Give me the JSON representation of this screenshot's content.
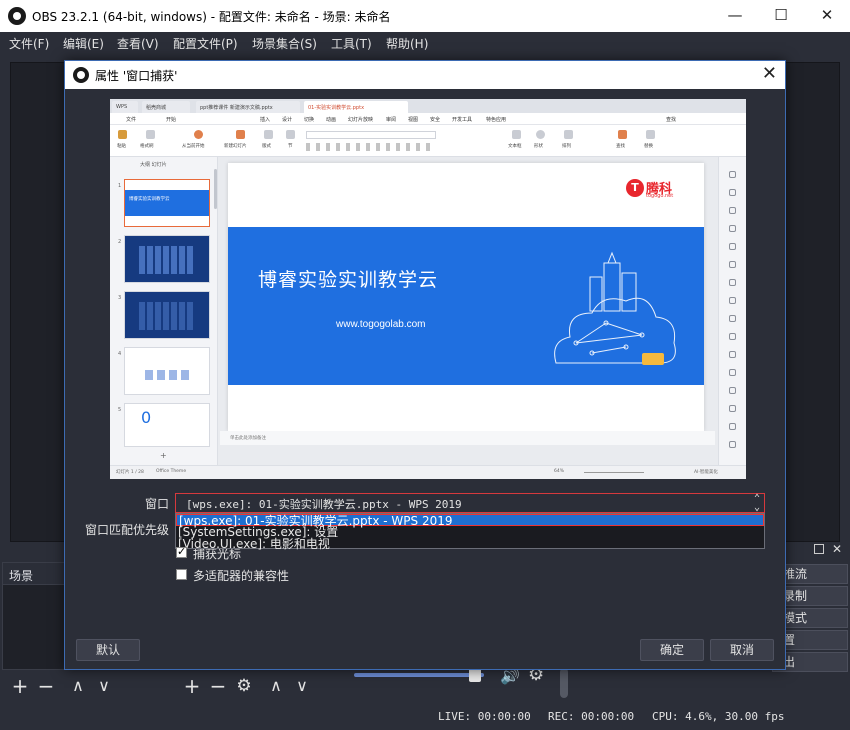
{
  "window": {
    "title": "OBS 23.2.1 (64-bit, windows) - 配置文件: 未命名 - 场景: 未命名",
    "minimize": "—",
    "maximize": "☐",
    "close": "✕"
  },
  "menu": [
    {
      "label": "文件(F)"
    },
    {
      "label": "编辑(E)"
    },
    {
      "label": "查看(V)"
    },
    {
      "label": "配置文件(P)"
    },
    {
      "label": "场景集合(S)"
    },
    {
      "label": "工具(T)"
    },
    {
      "label": "帮助(H)"
    }
  ],
  "docks": {
    "scenes_title": "场景",
    "close_icon": "✕",
    "toolbar_add": "+",
    "toolbar_remove": "−",
    "toolbar_up": "∧",
    "toolbar_down": "∨",
    "toolbar_gear": "⚙",
    "mixer_speaker": "🔊",
    "mixer_gear": "⚙",
    "mixer_volume_fraction": 0.93
  },
  "controls": {
    "buttons": [
      "推流",
      "录制",
      "模式",
      "置",
      "出"
    ]
  },
  "status": {
    "live": "LIVE: 00:00:00",
    "rec": "REC: 00:00:00",
    "cpu": "CPU: 4.6%, 30.00 fps"
  },
  "dialog": {
    "title": "属性 '窗口捕获'",
    "close": "✕",
    "window_label": "窗口",
    "priority_label": "窗口匹配优先级",
    "selected_window": "[wps.exe]: 01-实验实训教学云.pptx - WPS 2019",
    "dropdown_items": [
      "[wps.exe]: 01-实验实训教学云.pptx - WPS 2019",
      "[SystemSettings.exe]: 设置",
      "[Video.UI.exe]: 电影和电视"
    ],
    "capture_cursor_label": "捕获光标",
    "capture_cursor_checked": true,
    "multi_adapter_label": "多适配器的兼容性",
    "multi_adapter_checked": false,
    "defaults_button": "默认",
    "ok_button": "确定",
    "cancel_button": "取消",
    "combo_arrow": "⌃⌄"
  },
  "wps": {
    "tabs": [
      "WPS",
      "稻壳商城",
      "ppt推荐课件  新建演示文稿.pptx",
      "01-实验实训教学云.pptx"
    ],
    "ribbon_tabs": [
      "文件",
      "开始",
      "插入",
      "设计",
      "切换",
      "动画",
      "幻灯片放映",
      "审阅",
      "视图",
      "安全",
      "开发工具",
      "特色应用",
      "查找"
    ],
    "ribbon_labels": [
      "粘贴",
      "格式刷",
      "从当前开始",
      "新建幻灯片",
      "版式",
      "节",
      "文本框",
      "形状",
      "排列",
      "查找",
      "替换"
    ],
    "left_tabs": "大纲   幻灯片",
    "slide_title": "博睿实验实训教学云",
    "slide_url": "www.togogolab.com",
    "logo_text": "腾科",
    "logo_sub": "togogo.net",
    "notes_text": "单击此处添加备注",
    "status_left": "幻灯片 1 / 28",
    "status_theme": "Office Theme",
    "status_zoom": "64%",
    "status_right": "AI·智能美化",
    "thumb_title": "博睿实验实训教学云",
    "thumb_zero": "0",
    "thumb_numbers": [
      "1",
      "2",
      "3",
      "4",
      "5"
    ]
  },
  "colors": {
    "obs_bg": "#2b2e38",
    "accent_blue": "#1f6fe0",
    "focus_red": "#d6393d",
    "logo_red": "#e8262d"
  }
}
